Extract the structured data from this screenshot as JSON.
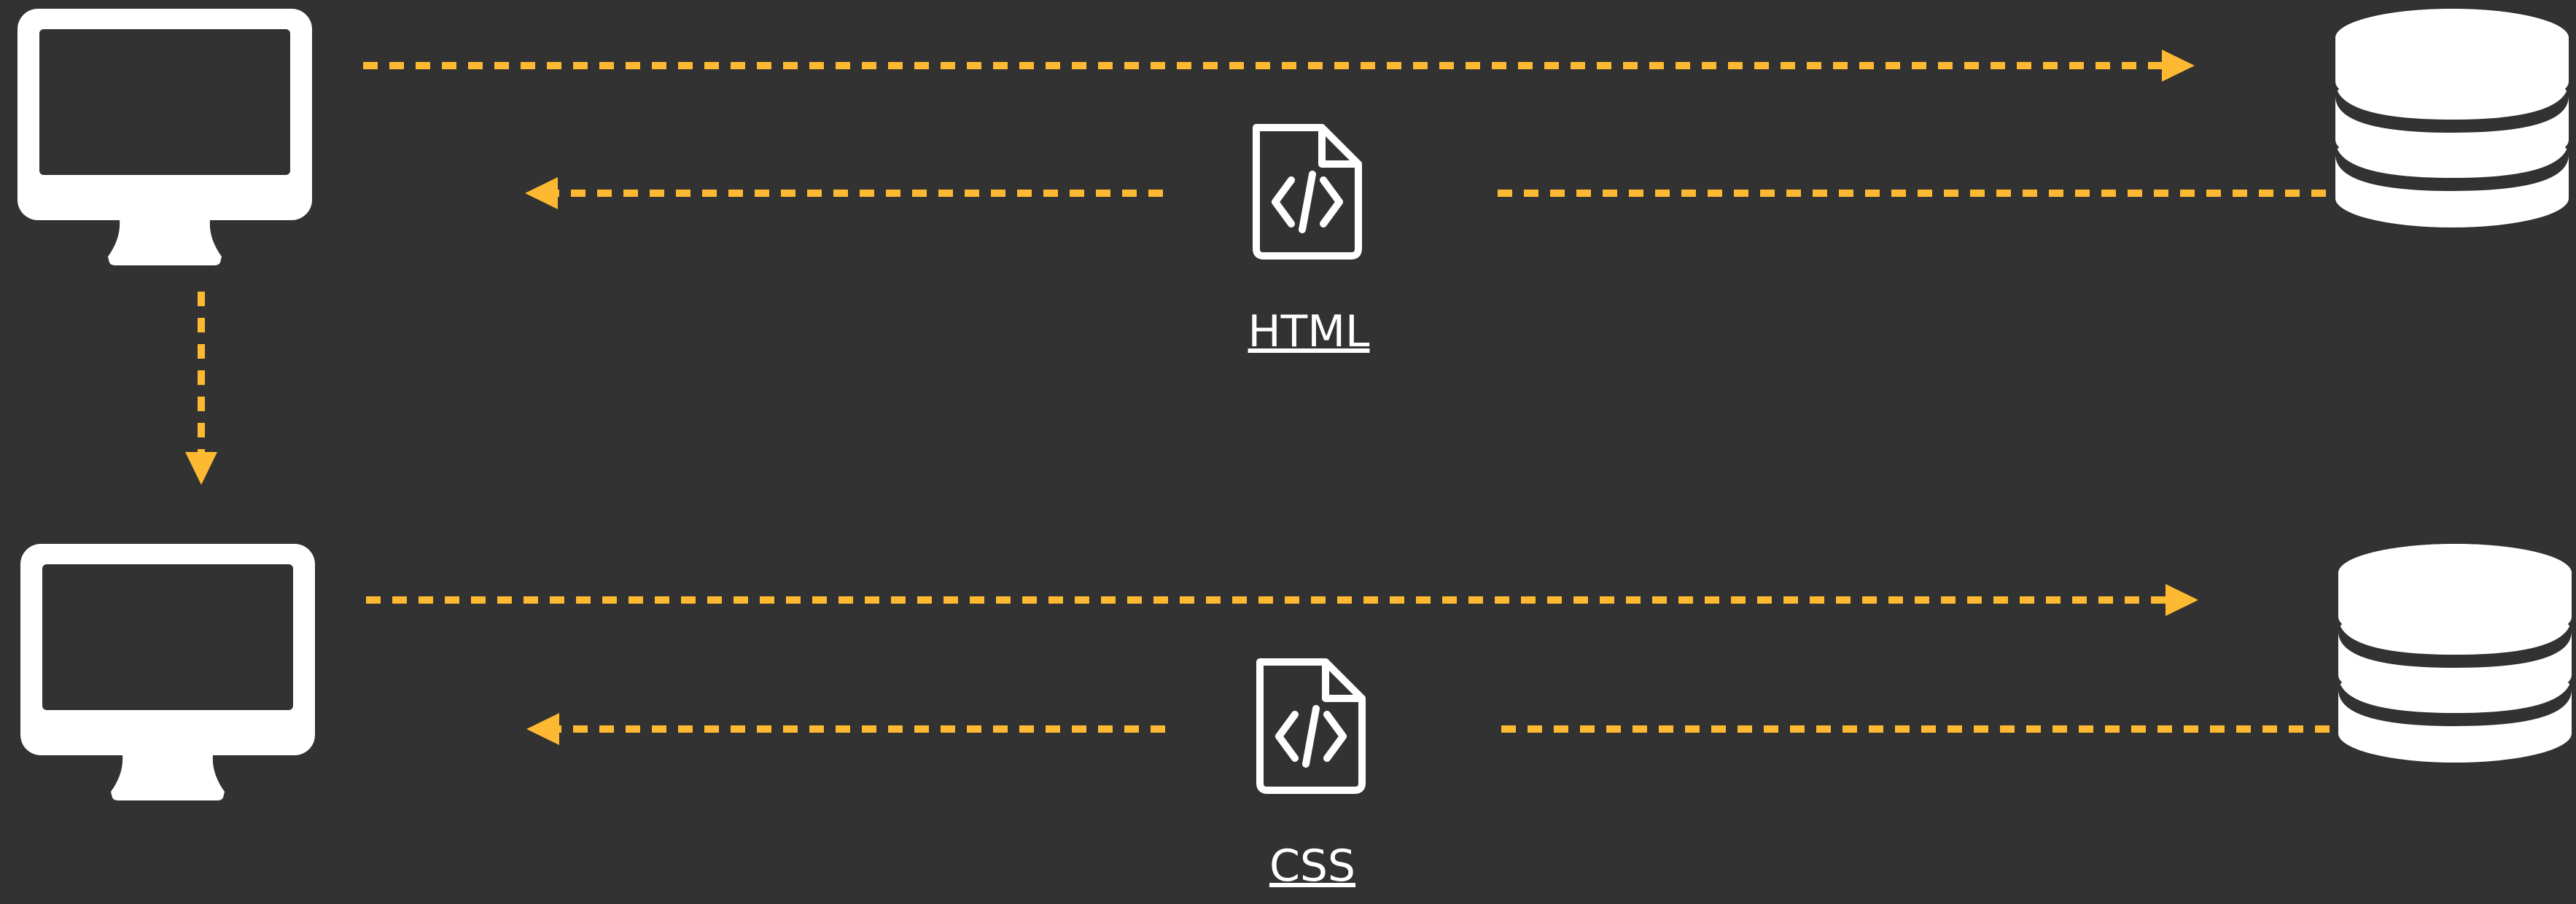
{
  "documents": {
    "top": {
      "label": "HTML",
      "icon": "file-code-icon"
    },
    "bottom": {
      "label": "CSS",
      "icon": "file-code-icon"
    }
  },
  "icons": {
    "client": "monitor-icon",
    "server": "database-icon"
  },
  "colors": {
    "background": "#323232",
    "arrow": "#fdb931",
    "icon": "#ffffff"
  }
}
